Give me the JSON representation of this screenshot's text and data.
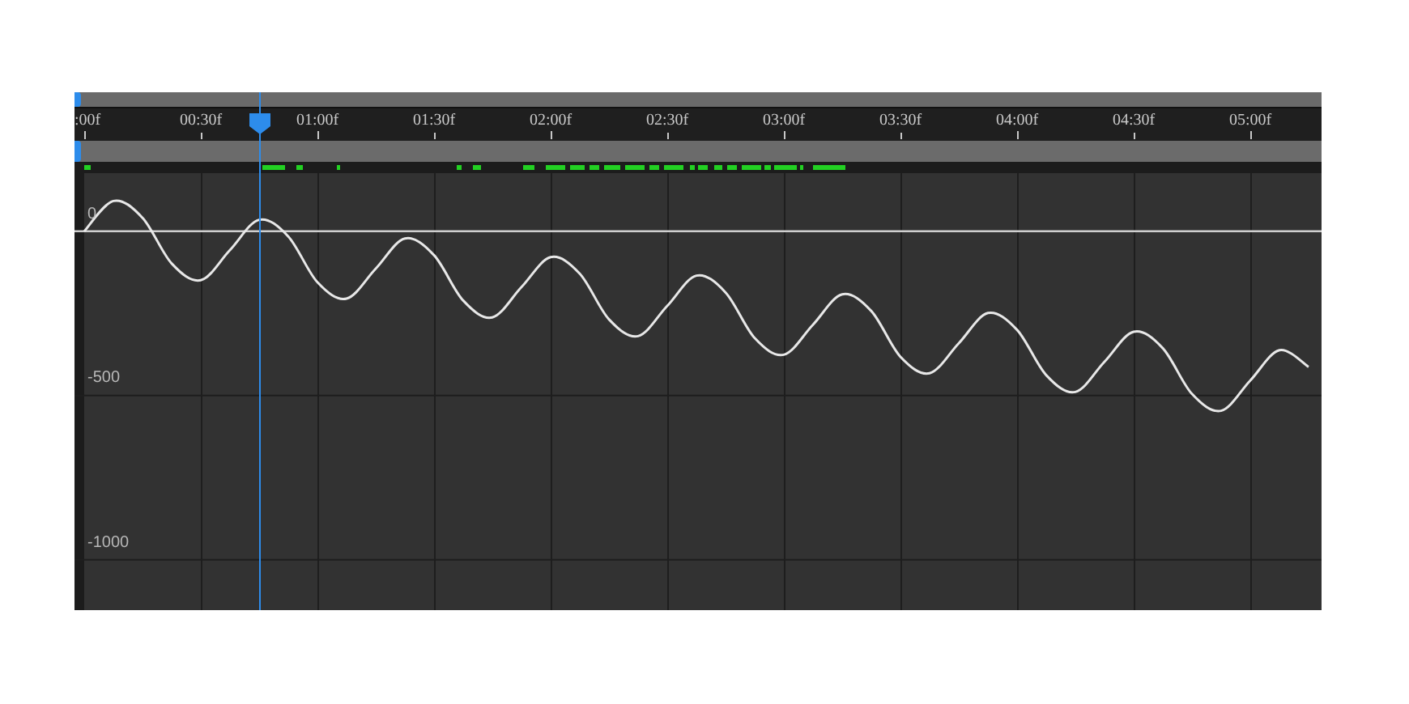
{
  "graph": {
    "chart_data": {
      "type": "line",
      "categories": [
        ":00f",
        null,
        null,
        null,
        "00:30f",
        null,
        null,
        null,
        "01:00f",
        null,
        null,
        null,
        "01:30f",
        null,
        null,
        null,
        "02:00f",
        null,
        null,
        null,
        "02:30f",
        null,
        null,
        null,
        "03:00f",
        null,
        null,
        null,
        "03:30f",
        null,
        null,
        null,
        "04:00f",
        null,
        null,
        null,
        "04:30f",
        null,
        null,
        null,
        "05:00f",
        null,
        null
      ],
      "series": [
        {
          "color": "#e8e8e8",
          "values": [
            0,
            92,
            41,
            -98,
            -149,
            -57,
            35,
            -16,
            -155,
            -205,
            -114,
            -22,
            -73,
            -211,
            -262,
            -170,
            -79,
            -129,
            -268,
            -319,
            -227,
            -135,
            -186,
            -325,
            -376,
            -284,
            -192,
            -243,
            -382,
            -432,
            -341,
            -249,
            -300,
            -438,
            -489,
            -397,
            -306,
            -356,
            -495,
            -546,
            -454,
            -362,
            -413
          ]
        }
      ],
      "grid": true,
      "ylim": [
        -1153,
        423
      ],
      "yticks": [
        {
          "value": 0,
          "label": "0"
        },
        {
          "value": -500,
          "label": "-500"
        },
        {
          "value": -1000,
          "label": "-1000"
        }
      ]
    }
  }
}
